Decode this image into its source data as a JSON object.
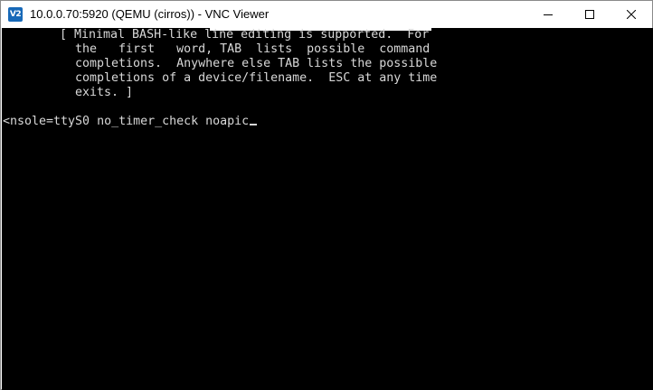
{
  "window": {
    "icon_text": "V2",
    "title": "10.0.0.70:5920 (QEMU (cirros)) - VNC Viewer"
  },
  "controls": {
    "minimize": "minimize-icon",
    "maximize": "maximize-icon",
    "close": "close-icon"
  },
  "console": {
    "help_lines": [
      "[ Minimal BASH-like line editing is supported.  For",
      "the   first   word, TAB  lists  possible  command",
      "completions.  Anywhere else TAB lists the possible",
      "completions of a device/filename.  ESC at any time",
      "exits. ]"
    ],
    "command_line": "<nsole=ttyS0 no_timer_check noapic"
  },
  "colors": {
    "console_bg": "#000000",
    "console_fg": "#d8d8d8",
    "titlebar_bg": "#ffffff",
    "icon_bg": "#1769b8"
  }
}
